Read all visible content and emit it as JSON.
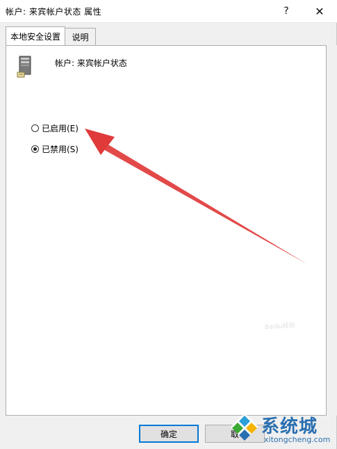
{
  "window": {
    "title": "帐户: 来宾帐户状态 属性",
    "help_label": "?",
    "close_label": "✕"
  },
  "tabs": [
    {
      "label": "本地安全设置",
      "active": true
    },
    {
      "label": "说明",
      "active": false
    }
  ],
  "policy": {
    "icon": "server-icon",
    "name": "帐户: 来宾帐户状态"
  },
  "options": [
    {
      "label": "已启用(E)",
      "selected": false
    },
    {
      "label": "已禁用(S)",
      "selected": true
    }
  ],
  "buttons": {
    "ok_label": "确定",
    "cancel_label": "取"
  },
  "annotation": {
    "arrow_color": "#e03a3a",
    "points_to": "已启用(E)"
  },
  "watermark": {
    "text": "系统城",
    "url": "xitongcheng.com",
    "faint_text": "Baidu经验"
  },
  "colors": {
    "accent": "#0078d7",
    "dialog_bg": "#f0f0f0",
    "panel_bg": "#ffffff",
    "watermark_blue": "#2a6fb0"
  }
}
